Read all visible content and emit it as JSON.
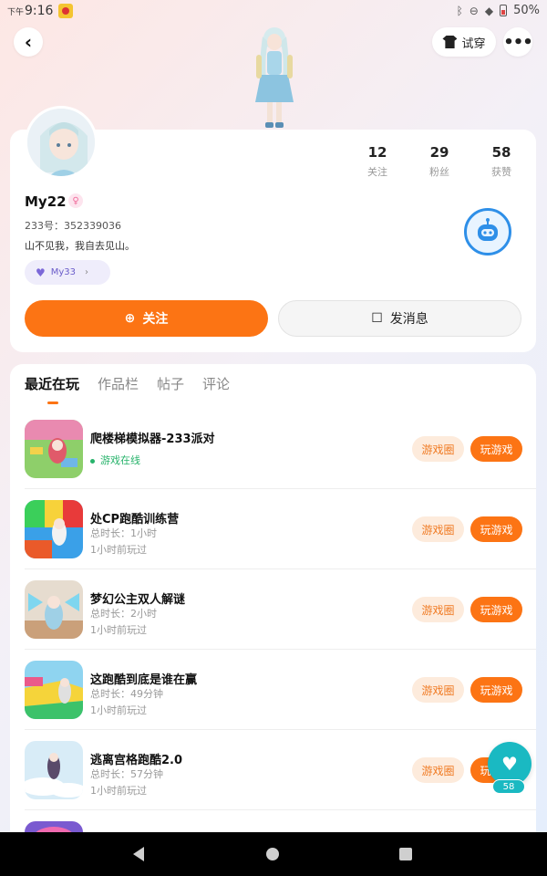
{
  "status_bar": {
    "ampm": "下午",
    "time": "9:16",
    "battery": "50%"
  },
  "header": {
    "try_on_label": "试穿"
  },
  "profile": {
    "stats": [
      {
        "value": "12",
        "label": "关注"
      },
      {
        "value": "29",
        "label": "粉丝"
      },
      {
        "value": "58",
        "label": "获赞"
      }
    ],
    "username": "My22",
    "uid": "233号：352339036",
    "bio": "山不见我，我自去见山。",
    "club_tag": "My33",
    "follow_label": "关注",
    "message_label": "发消息"
  },
  "tabs": [
    {
      "label": "最近在玩",
      "active": true
    },
    {
      "label": "作品栏",
      "active": false
    },
    {
      "label": "帖子",
      "active": false
    },
    {
      "label": "评论",
      "active": false
    }
  ],
  "games": [
    {
      "name": "爬楼梯模拟器-233派对",
      "line1": "游戏在线",
      "line2": "",
      "online": true,
      "circle_label": "游戏圈",
      "play_label": "玩游戏"
    },
    {
      "name": "处CP跑酷训练营",
      "line1": "总时长：1小时",
      "line2": "1小时前玩过",
      "online": false,
      "circle_label": "游戏圈",
      "play_label": "玩游戏"
    },
    {
      "name": "梦幻公主双人解谜",
      "line1": "总时长：2小时",
      "line2": "1小时前玩过",
      "online": false,
      "circle_label": "游戏圈",
      "play_label": "玩游戏"
    },
    {
      "name": "这跑酷到底是谁在赢",
      "line1": "总时长：49分钟",
      "line2": "1小时前玩过",
      "online": false,
      "circle_label": "游戏圈",
      "play_label": "玩游戏"
    },
    {
      "name": "逃离宫格跑酷2.0",
      "line1": "总时长：57分钟",
      "line2": "1小时前玩过",
      "online": false,
      "circle_label": "游戏圈",
      "play_label": "玩游戏"
    }
  ],
  "like_fab": {
    "count": "58"
  },
  "colors": {
    "accent": "#fc7414",
    "online": "#27b36b",
    "like": "#1ab9c2"
  }
}
